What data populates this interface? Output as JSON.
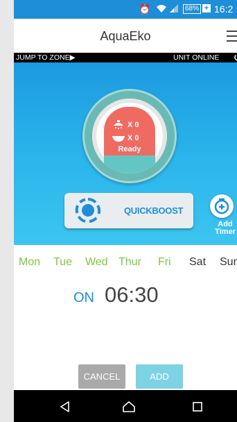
{
  "status_bar": {
    "battery": "68%",
    "time": "16:2"
  },
  "app_bar": {
    "title": "AquaEko"
  },
  "zone_bar": {
    "jump_label": "JUMP TO ZONE",
    "status_label": "UNIT ONLINE"
  },
  "tank": {
    "shower_count": "X 0",
    "bath_count": "X 0",
    "state": "Ready"
  },
  "quickboost": {
    "label": "QUICKBOOST"
  },
  "add_timer": {
    "label_line1": "Add",
    "label_line2": "Timer"
  },
  "days": [
    {
      "label": "Mon",
      "active": true
    },
    {
      "label": "Tue",
      "active": true
    },
    {
      "label": "Wed",
      "active": true
    },
    {
      "label": "Thur",
      "active": true
    },
    {
      "label": "Fri",
      "active": true
    },
    {
      "label": "Sat",
      "active": false
    },
    {
      "label": "Sun",
      "active": false
    }
  ],
  "schedule": {
    "state": "ON",
    "time": "06:30"
  },
  "actions": {
    "cancel_label": "CANCEL",
    "add_label": "ADD"
  },
  "colors": {
    "accent_blue": "#1f8ed8",
    "active_day_green": "#7ec642",
    "tank_red": "#ef6b62",
    "tank_teal": "#64c6c2"
  },
  "icons": {
    "status": [
      "alarm-icon",
      "wifi-icon",
      "signal-icon",
      "battery-icon",
      "charging-icon"
    ],
    "nav": [
      "back-icon",
      "home-icon",
      "recents-icon"
    ]
  }
}
